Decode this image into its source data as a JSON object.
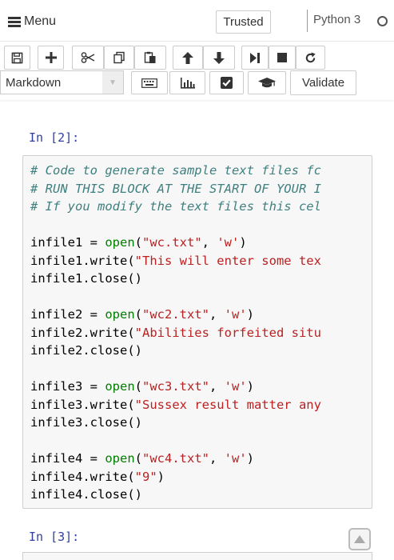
{
  "header": {
    "menu_label": "Menu",
    "trusted_label": "Trusted",
    "kernel_name": "Python 3"
  },
  "toolbar": {
    "cell_type": "Markdown",
    "validate_label": "Validate"
  },
  "cells": [
    {
      "prompt": "In [2]:",
      "lines": [
        [
          {
            "t": "com",
            "v": "# Code to generate sample text files fc"
          }
        ],
        [
          {
            "t": "com",
            "v": "# RUN THIS BLOCK AT THE START OF YOUR I"
          }
        ],
        [
          {
            "t": "com",
            "v": "# If you modify the text files this cel"
          }
        ],
        [],
        [
          {
            "t": "op",
            "v": "infile1 = "
          },
          {
            "t": "kw",
            "v": "open"
          },
          {
            "t": "op",
            "v": "("
          },
          {
            "t": "str",
            "v": "\"wc.txt\""
          },
          {
            "t": "op",
            "v": ", "
          },
          {
            "t": "str",
            "v": "'w'"
          },
          {
            "t": "op",
            "v": ")"
          }
        ],
        [
          {
            "t": "op",
            "v": "infile1.write("
          },
          {
            "t": "str",
            "v": "\"This will enter some tex"
          }
        ],
        [
          {
            "t": "op",
            "v": "infile1.close()"
          }
        ],
        [],
        [
          {
            "t": "op",
            "v": "infile2 = "
          },
          {
            "t": "kw",
            "v": "open"
          },
          {
            "t": "op",
            "v": "("
          },
          {
            "t": "str",
            "v": "\"wc2.txt\""
          },
          {
            "t": "op",
            "v": ", "
          },
          {
            "t": "str",
            "v": "'w'"
          },
          {
            "t": "op",
            "v": ")"
          }
        ],
        [
          {
            "t": "op",
            "v": "infile2.write("
          },
          {
            "t": "str",
            "v": "\"Abilities forfeited situ"
          }
        ],
        [
          {
            "t": "op",
            "v": "infile2.close()"
          }
        ],
        [],
        [
          {
            "t": "op",
            "v": "infile3 = "
          },
          {
            "t": "kw",
            "v": "open"
          },
          {
            "t": "op",
            "v": "("
          },
          {
            "t": "str",
            "v": "\"wc3.txt\""
          },
          {
            "t": "op",
            "v": ", "
          },
          {
            "t": "str",
            "v": "'w'"
          },
          {
            "t": "op",
            "v": ")"
          }
        ],
        [
          {
            "t": "op",
            "v": "infile3.write("
          },
          {
            "t": "str",
            "v": "\"Sussex result matter any"
          }
        ],
        [
          {
            "t": "op",
            "v": "infile3.close()"
          }
        ],
        [],
        [
          {
            "t": "op",
            "v": "infile4 = "
          },
          {
            "t": "kw",
            "v": "open"
          },
          {
            "t": "op",
            "v": "("
          },
          {
            "t": "str",
            "v": "\"wc4.txt\""
          },
          {
            "t": "op",
            "v": ", "
          },
          {
            "t": "str",
            "v": "'w'"
          },
          {
            "t": "op",
            "v": ")"
          }
        ],
        [
          {
            "t": "op",
            "v": "infile4.write("
          },
          {
            "t": "str",
            "v": "\"9\""
          },
          {
            "t": "op",
            "v": ")"
          }
        ],
        [
          {
            "t": "op",
            "v": "infile4.close()"
          }
        ]
      ]
    },
    {
      "prompt": "In [3]:"
    }
  ],
  "colors": {
    "prompt": "#303f9f",
    "comment": "#408080",
    "keyword": "#008000",
    "string": "#ba2121"
  },
  "icons": [
    "menu-icon",
    "save-icon",
    "plus-icon",
    "scissors-icon",
    "copy-icon",
    "paste-icon",
    "arrow-up-icon",
    "arrow-down-icon",
    "step-forward-icon",
    "stop-icon",
    "restart-icon",
    "keyboard-icon",
    "bar-chart-icon",
    "checkbox-icon",
    "graduation-cap-icon",
    "scroll-up-icon"
  ]
}
